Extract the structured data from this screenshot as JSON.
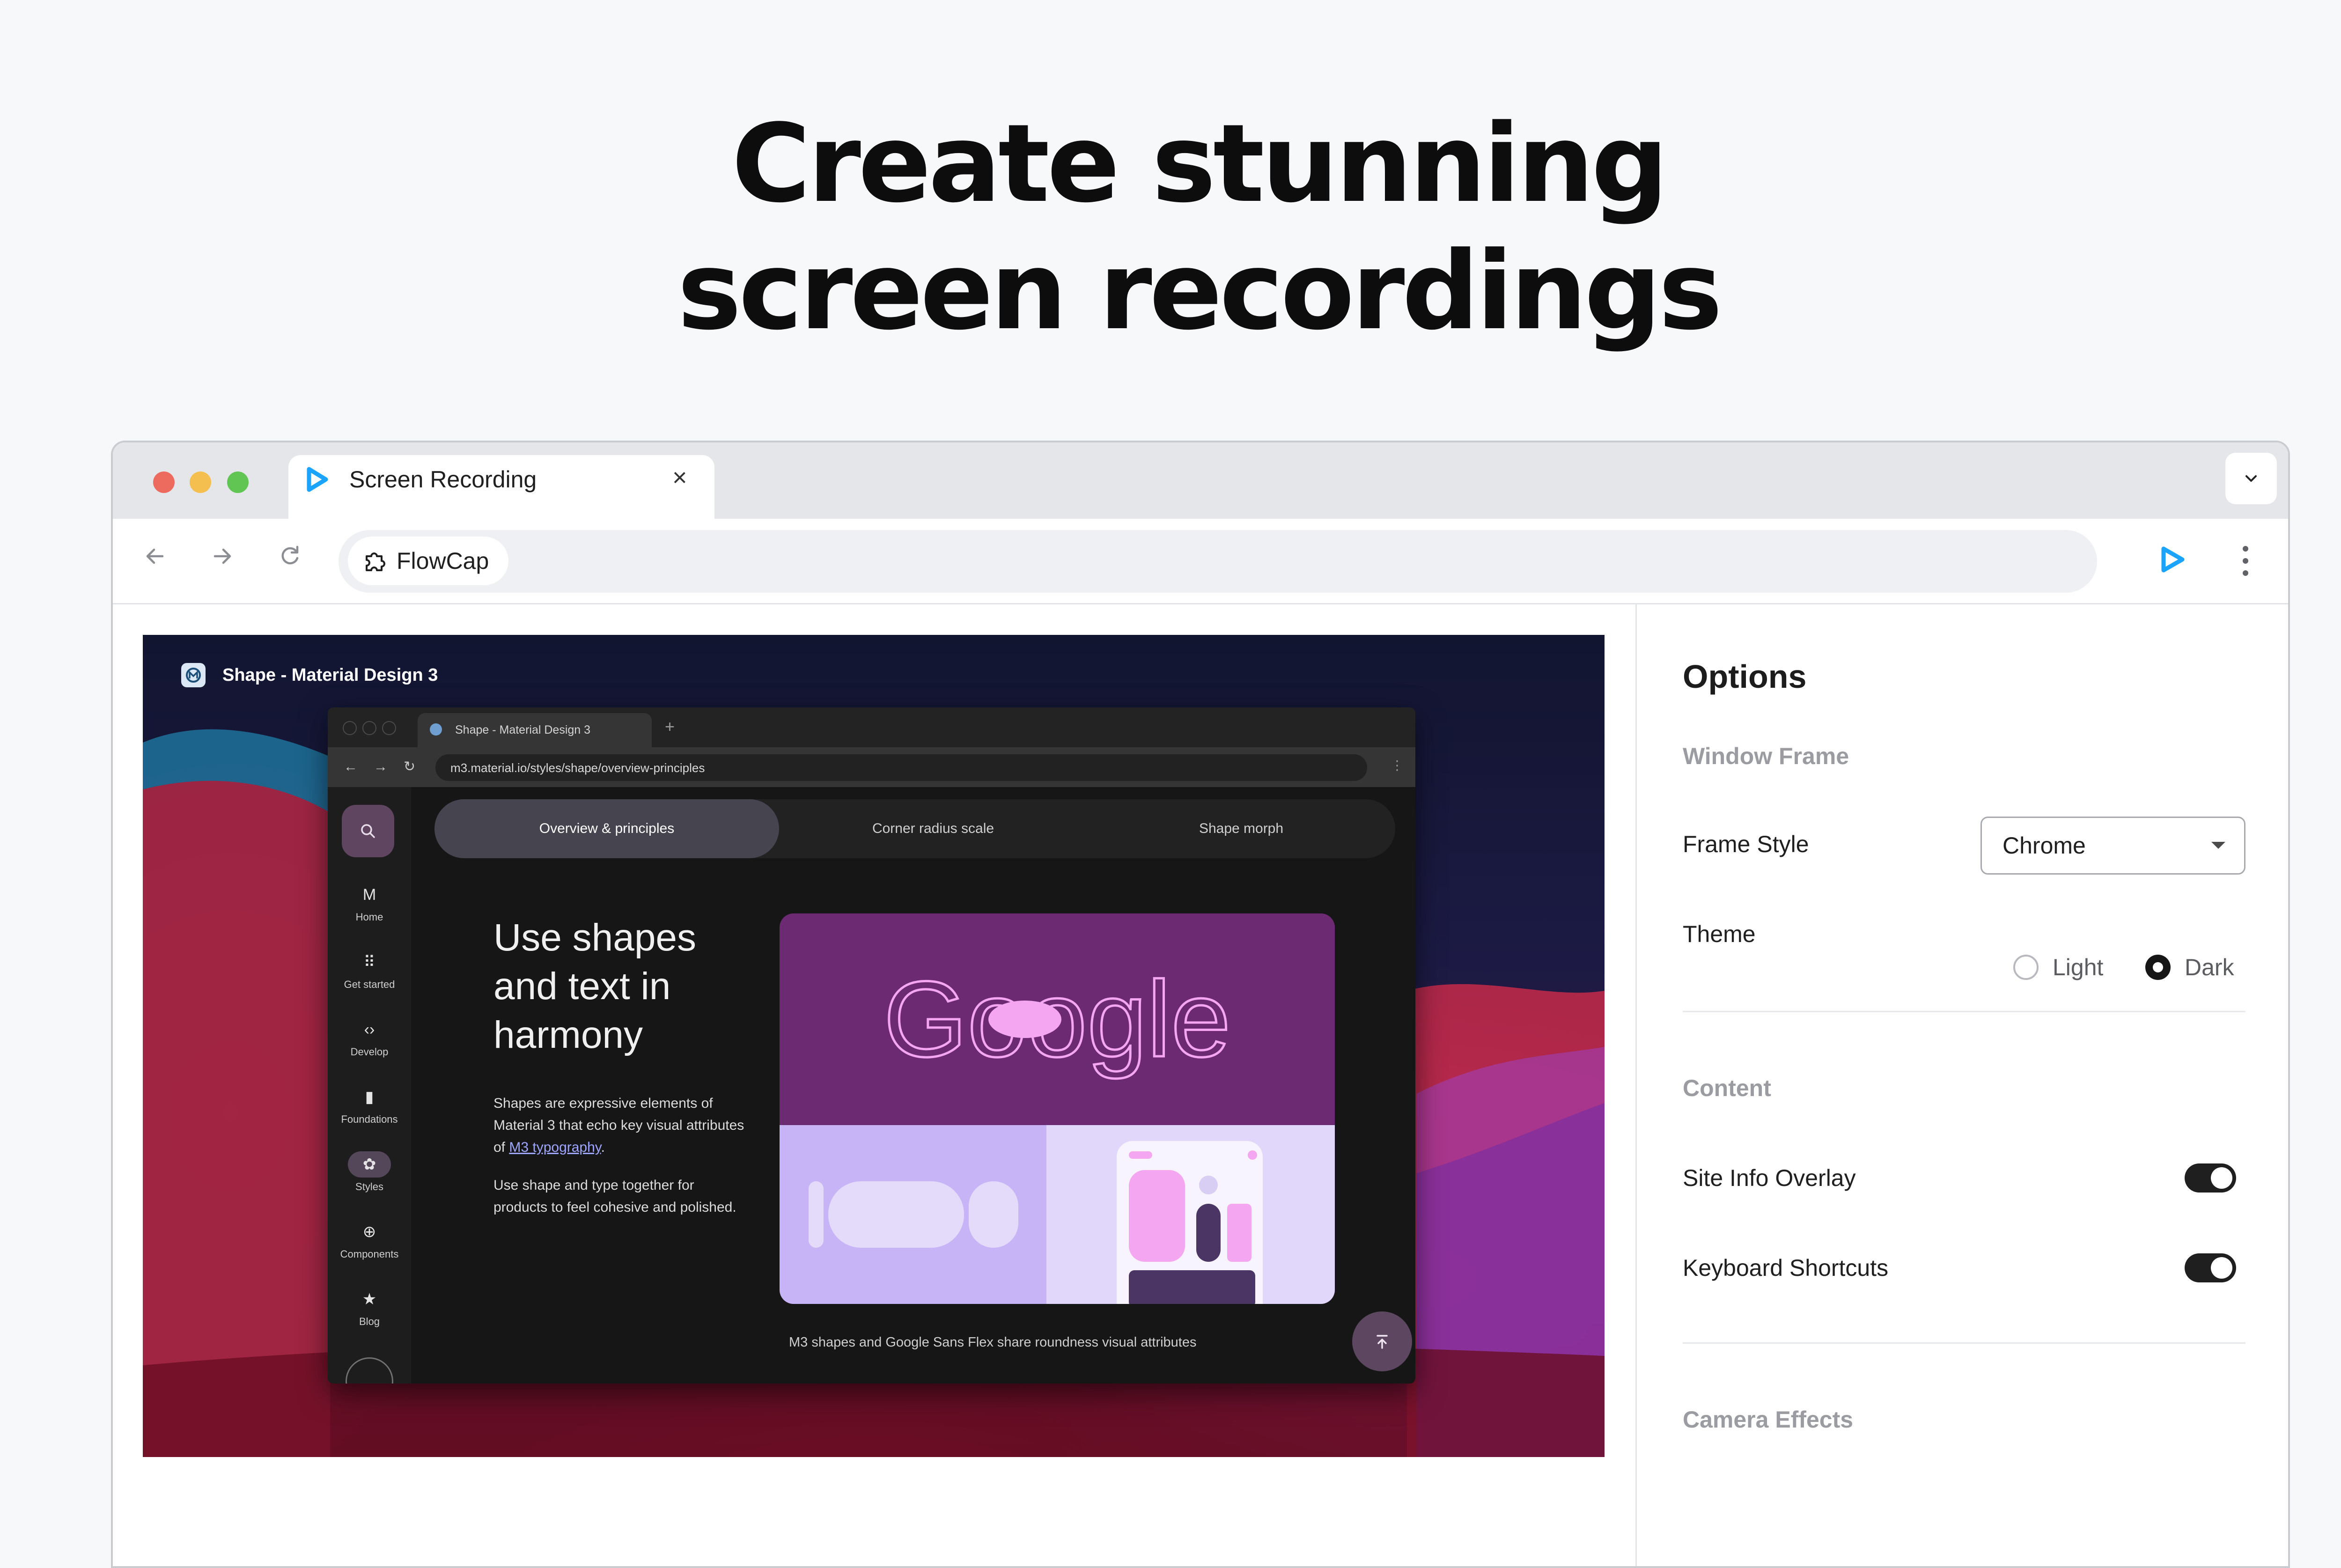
{
  "headline": {
    "line1": "Create stunning",
    "line2": "screen recordings"
  },
  "browser": {
    "tab_title": "Screen Recording",
    "tab_close": "×",
    "omnibox_chip": "FlowCap"
  },
  "preview": {
    "site_title": "Shape - Material Design 3",
    "inner_tab_title": "Shape - Material Design 3",
    "inner_new_tab": "+",
    "inner_url": "m3.material.io/styles/shape/overview-principles",
    "rail": [
      {
        "glyph": "M",
        "label": "Home"
      },
      {
        "glyph": "⠿",
        "label": "Get started"
      },
      {
        "glyph": "‹›",
        "label": "Develop"
      },
      {
        "glyph": "▮",
        "label": "Foundations"
      },
      {
        "glyph": "✿",
        "label": "Styles"
      },
      {
        "glyph": "⊕",
        "label": "Components"
      },
      {
        "glyph": "★",
        "label": "Blog"
      }
    ],
    "tabs": [
      "Overview & principles",
      "Corner radius scale",
      "Shape morph"
    ],
    "heading": "Use shapes and text in harmony",
    "body1_pre": "Shapes are expressive elements of Material 3 that echo key visual attributes of ",
    "body1_link": "M3 typography",
    "body1_post": ".",
    "body2": "Use shape and type together for products to feel cohesive and polished.",
    "card_wordmark": "Google",
    "caption": "M3 shapes and Google Sans Flex share roundness visual attributes"
  },
  "options": {
    "title": "Options",
    "window_frame": "Window Frame",
    "frame_style_label": "Frame Style",
    "frame_style_value": "Chrome",
    "theme_label": "Theme",
    "theme_light": "Light",
    "theme_dark": "Dark",
    "theme_selected": "Dark",
    "content": "Content",
    "site_info_overlay": "Site Info Overlay",
    "site_info_overlay_on": true,
    "keyboard_shortcuts": "Keyboard Shortcuts",
    "keyboard_shortcuts_on": true,
    "camera_effects": "Camera Effects"
  },
  "colors": {
    "brand_accent": "#1aa3ff",
    "toggle_on": "#1f1f1f",
    "card_purple": "#6b2a72",
    "card_lavender": "#c6b4f7"
  }
}
